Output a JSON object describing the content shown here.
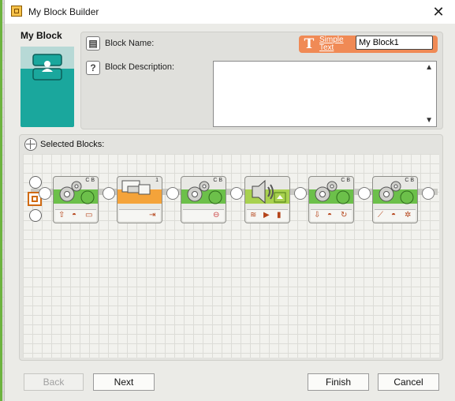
{
  "window": {
    "title": "My Block Builder",
    "close_glyph": "✕"
  },
  "left_panel": {
    "title": "My Block"
  },
  "block_name": {
    "label": "Block Name:",
    "value": "My Block1",
    "text_link_line1": "Simple",
    "text_link_line2": "Text"
  },
  "block_description": {
    "label": "Block Description:",
    "value": ""
  },
  "selected_blocks": {
    "header": "Selected Blocks:",
    "blocks": [
      {
        "type": "move",
        "badge": "C B",
        "band_color": "#6cc04a",
        "icons": [
          "up-arrow-icon",
          "wheel-icon",
          "tank-icon"
        ]
      },
      {
        "type": "display",
        "badge": "1",
        "band_color": "#f4a33a",
        "icons": [
          "arrow-right-icon"
        ]
      },
      {
        "type": "move",
        "badge": "C B",
        "band_color": "#6cc04a",
        "icons": [
          "stop-icon"
        ]
      },
      {
        "type": "sound",
        "badge": "",
        "band_color": "#a8d14f",
        "icons": [
          "wave-icon",
          "play-icon",
          "volume-icon"
        ]
      },
      {
        "type": "move",
        "badge": "C B",
        "band_color": "#6cc04a",
        "icons": [
          "down-arrow-icon",
          "wheel-icon",
          "rotate-icon"
        ]
      },
      {
        "type": "move",
        "badge": "C B",
        "band_color": "#6cc04a",
        "icons": [
          "steer-icon",
          "wheel-icon",
          "gear-small-icon"
        ]
      }
    ]
  },
  "buttons": {
    "back": "Back",
    "next": "Next",
    "finish": "Finish",
    "cancel": "Cancel"
  },
  "colors": {
    "accent_orange": "#f08a55",
    "teal": "#1aa79d",
    "move_green": "#6cc04a",
    "display_orange": "#f4a33a"
  }
}
